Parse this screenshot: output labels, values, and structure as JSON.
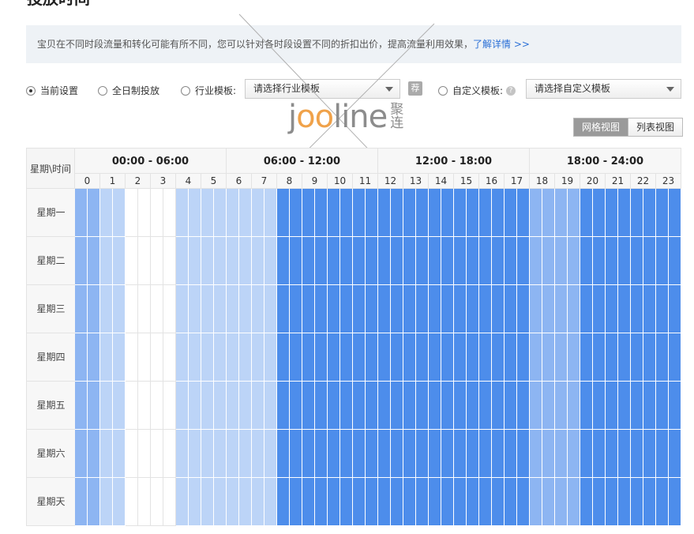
{
  "page": {
    "title": "投放时间",
    "info_text": "宝贝在不同时段流量和转化可能有所不同，您可以针对各时段设置不同的折扣出价，提高流量利用效果，",
    "info_link": "了解详情 >>"
  },
  "options": {
    "radio_current": "当前设置",
    "radio_all_day": "全日制投放",
    "radio_industry": "行业模板:",
    "industry_select": "请选择行业模板",
    "recommend_badge": "荐",
    "radio_custom": "自定义模板:",
    "help_icon": "?",
    "custom_select": "请选择自定义模板",
    "selected": "current"
  },
  "watermark": {
    "logo": "jooline",
    "text": "聚连"
  },
  "view_toggle": {
    "grid": "网格视图",
    "list": "列表视图",
    "active": "grid"
  },
  "schedule": {
    "corner_label": "星期\\时间",
    "ranges": [
      "00:00 - 06:00",
      "06:00 - 12:00",
      "12:00 - 18:00",
      "18:00 - 24:00"
    ],
    "hours": [
      "0",
      "1",
      "2",
      "3",
      "4",
      "5",
      "6",
      "7",
      "8",
      "9",
      "10",
      "11",
      "12",
      "13",
      "14",
      "15",
      "16",
      "17",
      "18",
      "19",
      "20",
      "21",
      "22",
      "23"
    ],
    "days": [
      "星期一",
      "星期二",
      "星期三",
      "星期四",
      "星期五",
      "星期六",
      "星期天"
    ],
    "colors": {
      "none": "#ffffff",
      "low": "#bcd4f7",
      "mid": "#8db5f2",
      "high": "#4d8deb"
    },
    "levels": [
      0.6,
      0.4,
      0,
      0,
      0.25,
      0.25,
      0.25,
      0.25,
      1,
      1,
      1,
      1,
      1,
      1,
      1,
      1,
      1,
      1,
      0.6,
      0.6,
      1,
      1,
      1,
      1
    ]
  }
}
